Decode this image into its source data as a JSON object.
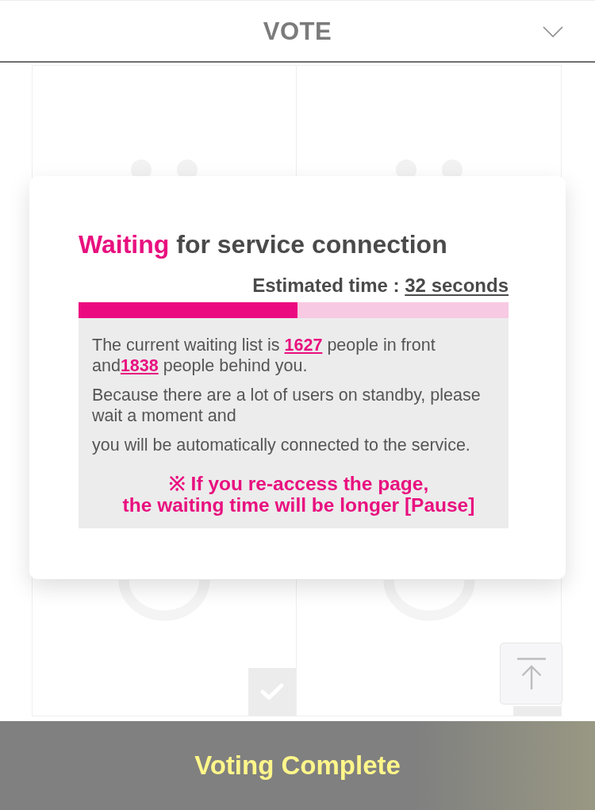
{
  "header": {
    "title": "VOTE"
  },
  "candidates": [
    {
      "selected": false
    },
    {
      "selected": false
    }
  ],
  "modal": {
    "title": {
      "highlight": "Waiting",
      "rest": "for service connection"
    },
    "estimate": {
      "label": "Estimated time :",
      "value": "32 seconds"
    },
    "progress": {
      "level": 0.51
    },
    "paragraphs": [
      "The current waiting list is **1627** people in front and**1838** people behind you.",
      "Because there are a lot of users on standby, please wait a moment and",
      "you will be automatically connected to the service."
    ],
    "notice": "※ If you re-access the page,\nthe waiting time will be longer [Pause]"
  },
  "footer": {
    "button": "Voting Complete"
  }
}
